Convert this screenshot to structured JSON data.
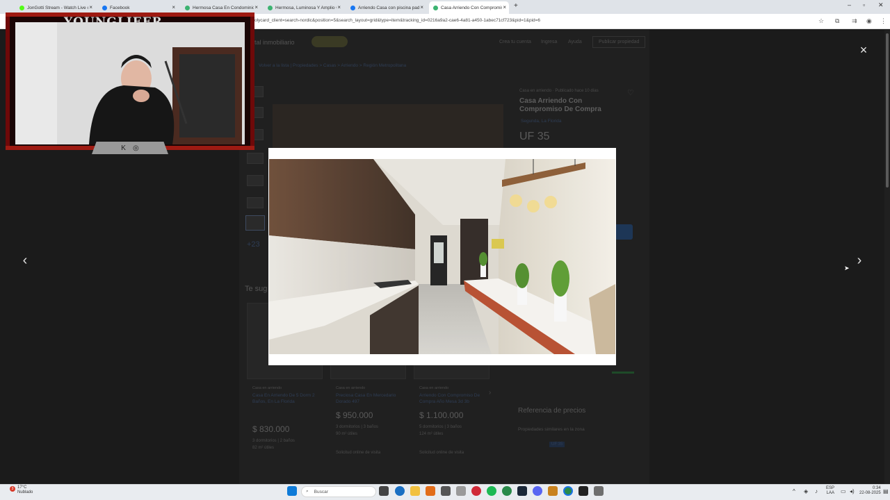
{
  "browser": {
    "tabs": [
      {
        "title": "JonGotti Stream - Watch Live o",
        "favicon_color": "#53fc18"
      },
      {
        "title": "Facebook",
        "favicon_color": "#1877f2"
      },
      {
        "title": "Hermosa Casa En Condominio",
        "favicon_color": "#3cb371"
      },
      {
        "title": "Hermosa, Luminosa Y Amplio C",
        "favicon_color": "#3cb371"
      },
      {
        "title": "Arriendo Casa con piscina pad",
        "favicon_color": "#1877f2"
      },
      {
        "title": "Casa Arriendo Con Compromis",
        "favicon_color": "#3cb371"
      }
    ],
    "active_tab_index": 5,
    "new_tab_icon": "+",
    "url": "olycard_client=search-nordic&position=5&search_layout=grid&type=item&tracking_id=0216a9a2-cae6-4a81-a450-1abec71cf723&pid=1&pid=6"
  },
  "page": {
    "logo": "tal inmobiliario",
    "nav": [
      "Crea tu cuenta",
      "Ingresa",
      "Ayuda",
      "Publicar propiedad"
    ],
    "breadcrumb": "Volver a la lista  |  Propiedades  >  Casas  >  Arriendo  >  Región Metropolitana",
    "listing_meta": "Casa en arriendo  ·  Publicado hace 10 días",
    "listing_title": "Casa Arriendo Con Compromiso De Compra",
    "listing_location": "Segunda, La Florida",
    "listing_price": "UF 35",
    "more_photos": "+23",
    "suggest_heading": "Te sug",
    "cards": [
      {
        "kind": "Casa en arriendo",
        "title": "Casa En Arriendo De 5 Dorm 2 Baños, En La Florida",
        "price": "$ 830.000",
        "specs": "3 dormitorios | 2 baños",
        "area": "82 m² útiles"
      },
      {
        "kind": "Casa en arriendo",
        "title": "Preciosa Casa En Mercedario Dorado 497",
        "price": "$ 950.000",
        "specs": "3 dormitorios | 3 baños",
        "area": "90 m² útiles",
        "action": "Solicitud online de visita"
      },
      {
        "kind": "Casa en arriendo",
        "title": "Arriendo Con Compromiso De Compra Año Mesa 3d 3b",
        "price": "$ 1.100.000",
        "specs": "5 dormitorios | 3 baños",
        "area": "124 m² útiles",
        "action": "Solicitud online de visita"
      }
    ],
    "price_reference_heading": "Referencia de precios",
    "similar_label": "Propiedades similares en la zona",
    "similar_tag": "UF 35"
  },
  "lightbox": {
    "close_icon": "×",
    "prev_icon": "‹",
    "next_icon": "›"
  },
  "webcam": {
    "brand": "YOUNGLIEER",
    "social_icons": [
      "kick-icon",
      "instagram-icon"
    ]
  },
  "taskbar": {
    "weather_temp": "17°C",
    "weather_desc": "Nublado",
    "notification_badge": "3",
    "search_placeholder": "Buscar",
    "lang_top": "ESP",
    "lang_bottom": "LAA",
    "time": "0:34",
    "date": "22-08-2025"
  },
  "colors": {
    "accent": "#3483fa",
    "overlay": "#1b1b1b",
    "webcam_frame": "#7a0a0a"
  }
}
